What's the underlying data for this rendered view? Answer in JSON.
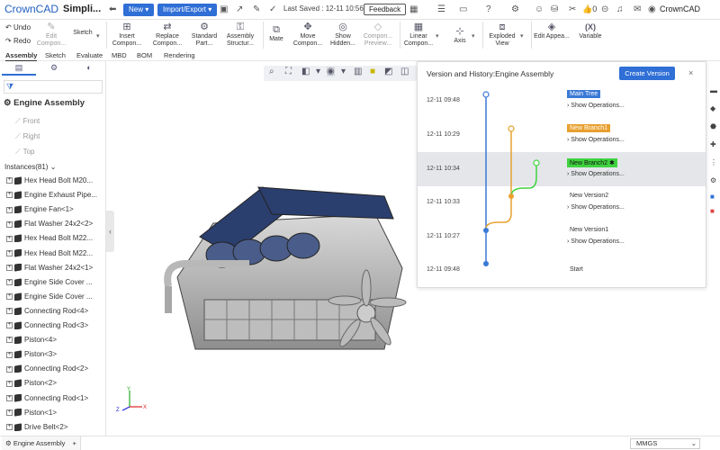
{
  "app": {
    "logo": "CrownCAD",
    "project_title": "Simpli..."
  },
  "topbar": {
    "new_label": "New",
    "import_label": "Import/Export",
    "saved_text": "Last Saved : 12-11 10:56",
    "feedback_label": "Feedback",
    "likes": "0",
    "user_name": "CrownCAD"
  },
  "ribbon": {
    "undo": "Undo",
    "redo": "Redo",
    "edit_component": "Edit Compon...",
    "sketch": "Sketch",
    "insert_component": "Insert Compon...",
    "replace_component": "Replace Compon...",
    "standard_part": "Standard Part...",
    "assembly_structure": "Assembly Structur...",
    "mate": "Mate",
    "move_component": "Move Compon...",
    "show_hidden": "Show Hidden...",
    "component_preview": "Compon... Preview...",
    "linear_component": "Linear Compon...",
    "axis": "Axis",
    "exploded_view": "Exploded View",
    "edit_appearance": "Edit Appea...",
    "variable": "Variable",
    "variable_symbol": "(X)"
  },
  "tabs": [
    "Assembly",
    "Sketch",
    "Evaluate",
    "MBD",
    "BOM",
    "Rendering"
  ],
  "left_panel": {
    "assembly_title": "Engine Assembly",
    "planes": [
      "Front",
      "Right",
      "Top"
    ],
    "instances_label": "Instances(81)",
    "items": [
      "Hex Head Bolt M20...",
      "Engine Exhaust Pipe...",
      "Engine Fan<1>",
      "Flat Washer 24x2<2>",
      "Hex Head Bolt M22...",
      "Hex Head Bolt M22...",
      "Flat Washer 24x2<1>",
      "Engine Side Cover ...",
      "Engine Side Cover ...",
      "Connecting Rod<4>",
      "Connecting Rod<3>",
      "Piston<4>",
      "Piston<3>",
      "Connecting Rod<2>",
      "Piston<2>",
      "Connecting Rod<1>",
      "Piston<1>",
      "Drive Belt<2>"
    ]
  },
  "version_panel": {
    "title": "Version and History:Engine Assembly",
    "create_label": "Create Version",
    "close": "×",
    "show_operations": "Show Operations...",
    "rows": [
      {
        "time": "12-11 09:48",
        "label": "Main Tree",
        "style": "blue",
        "ops": true
      },
      {
        "time": "12-11 10:29",
        "label": "New Branch1",
        "style": "orange",
        "ops": true
      },
      {
        "time": "12-11 10:34",
        "label": "New Branch2 ✱",
        "style": "green",
        "ops": true,
        "selected": true
      },
      {
        "time": "12-11 10:33",
        "label": "New Version2",
        "style": "plain",
        "ops": true
      },
      {
        "time": "12-11 10:27",
        "label": "New Version1",
        "style": "plain",
        "ops": true
      },
      {
        "time": "12-11 09:48",
        "label": "Start",
        "style": "plain",
        "ops": false
      }
    ],
    "colors": {
      "main": "#3a79d6",
      "branch1": "#e8a02f",
      "branch2": "#3fd33f"
    }
  },
  "bottom": {
    "doc_tab": "Engine Assembly",
    "units": "MMGS"
  },
  "triad": {
    "x": "X",
    "y": "Y",
    "z": "Z"
  }
}
